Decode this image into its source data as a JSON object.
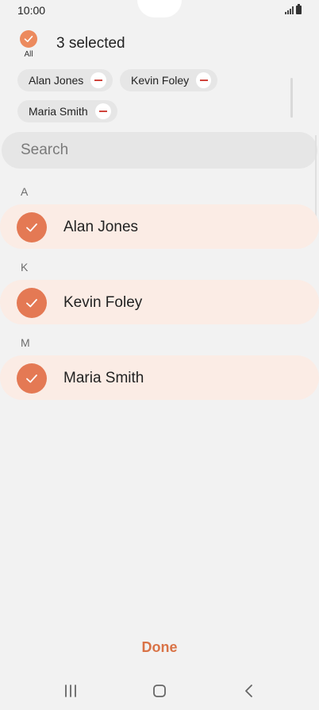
{
  "status_bar": {
    "time": "10:00"
  },
  "header": {
    "all_label": "All",
    "selected_count": "3 selected"
  },
  "chips": [
    {
      "label": "Alan Jones"
    },
    {
      "label": "Kevin Foley"
    },
    {
      "label": "Maria Smith"
    }
  ],
  "search": {
    "placeholder": "Search",
    "value": ""
  },
  "groups": [
    {
      "letter": "A",
      "name": "Alan Jones",
      "checked": true
    },
    {
      "letter": "K",
      "name": "Kevin Foley",
      "checked": true
    },
    {
      "letter": "M",
      "name": "Maria Smith",
      "checked": true
    }
  ],
  "footer": {
    "done_label": "Done"
  },
  "colors": {
    "accent": "#e47954",
    "done": "#d97347",
    "row_highlight": "#fbece5",
    "chip_remove": "#d0453d"
  },
  "icons": {
    "status": [
      "signal-icon",
      "battery-icon"
    ],
    "nav": [
      "recent-apps-icon",
      "home-icon",
      "back-icon"
    ]
  }
}
